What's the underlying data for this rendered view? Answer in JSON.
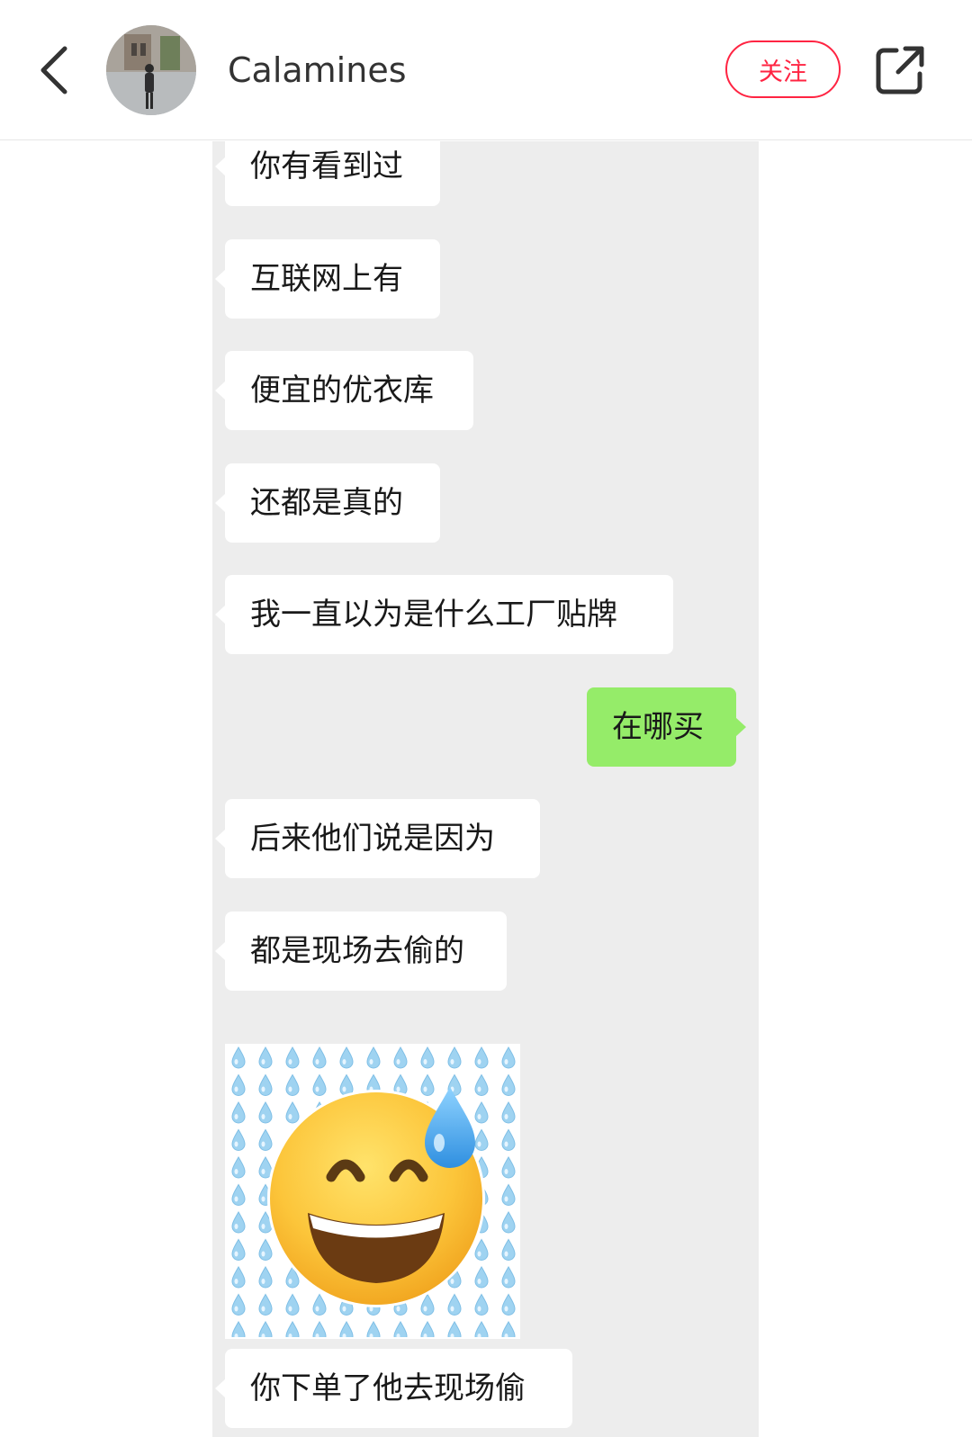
{
  "header": {
    "back_icon": "chevron-left-icon",
    "author_name": "Calamines",
    "follow_label": "关注",
    "share_icon": "external-share-icon",
    "accent_color": "#ff2442"
  },
  "chat": {
    "background_color": "#ededed",
    "left_bubble_color": "#ffffff",
    "right_bubble_color": "#95ec69",
    "messages": [
      {
        "side": "left",
        "text": "你有看到过"
      },
      {
        "side": "left",
        "text": "互联网上有"
      },
      {
        "side": "left",
        "text": "便宜的优衣库"
      },
      {
        "side": "left",
        "text": "还都是真的"
      },
      {
        "side": "left",
        "text": "我一直以为是什么工厂贴牌"
      },
      {
        "side": "right",
        "text": "在哪买"
      },
      {
        "side": "left",
        "text": "后来他们说是因为"
      },
      {
        "side": "left",
        "text": "都是现场去偷的"
      },
      {
        "side": "left",
        "text": "你下单了他去现场偷"
      }
    ],
    "sticker": "grinning-sweat-face-emoji"
  }
}
